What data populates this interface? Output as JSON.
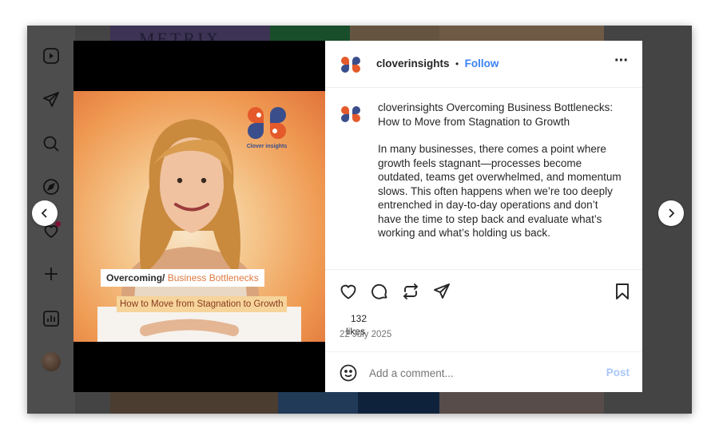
{
  "background": {
    "tile_text": "METRIX"
  },
  "sidebar": {
    "items": [
      {
        "icon": "reels-icon"
      },
      {
        "icon": "send-icon"
      },
      {
        "icon": "search-icon"
      },
      {
        "icon": "explore-icon"
      },
      {
        "icon": "heart-icon"
      },
      {
        "icon": "plus-icon"
      },
      {
        "icon": "stats-icon"
      },
      {
        "icon": "avatar"
      }
    ]
  },
  "post": {
    "image": {
      "brand_name": "Clover insights",
      "banner_line1_a": "Overcoming/",
      "banner_line1_b": " Business Bottlenecks",
      "banner_line2": "How to Move from Stagnation to Growth"
    },
    "header": {
      "username": "cloverinsights",
      "separator": "•",
      "follow_label": "Follow",
      "more_label": "···"
    },
    "caption": {
      "username": "cloverinsights",
      "title": "Overcoming Business Bottlenecks: How to Move from Stagnation to Growth",
      "body": "In many businesses, there comes a point where growth feels stagnant—processes become outdated, teams get overwhelmed, and momentum slows. This often happens when we’re too deeply entrenched in day-to-day operations and don’t have the time to step back and evaluate what’s working and what’s holding us back."
    },
    "likes": {
      "count": "132",
      "label": "likes"
    },
    "date": "22 July 2025",
    "comment": {
      "placeholder": "Add a comment...",
      "post_label": "Post"
    }
  },
  "colors": {
    "accent": "#3b82f6",
    "post_disabled": "#a8c7fa",
    "text": "#262626",
    "muted": "#737373"
  }
}
